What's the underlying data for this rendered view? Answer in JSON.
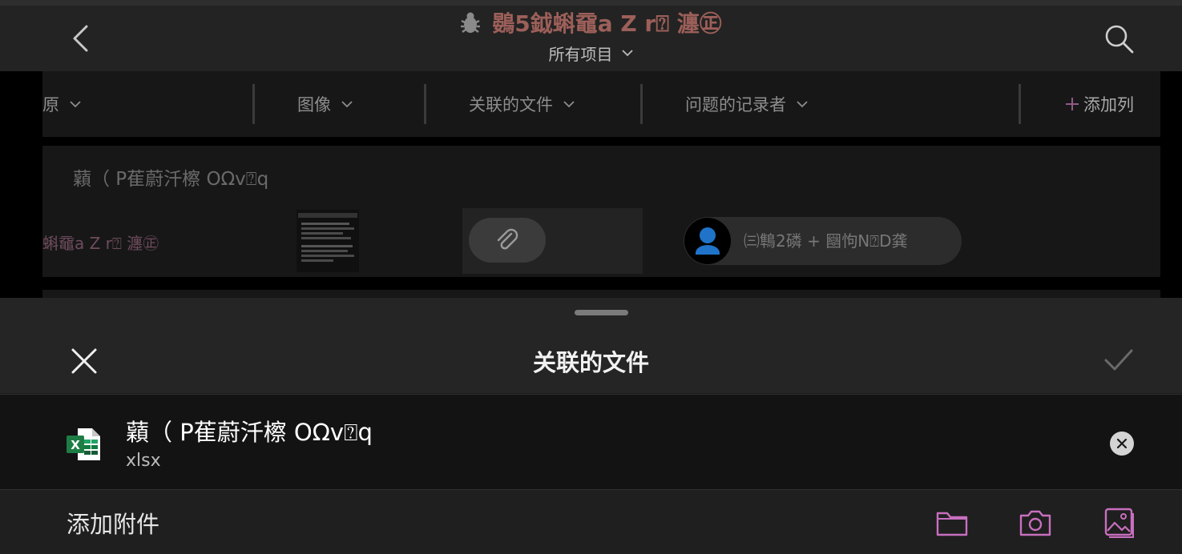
{
  "header": {
    "title": "鷃5鉞蝌黿a Z r⍰ 瀍㊣",
    "subtitle": "所有项目"
  },
  "columns": [
    {
      "label": "原"
    },
    {
      "label": "图像"
    },
    {
      "label": "关联的文件"
    },
    {
      "label": "问题的记录者"
    }
  ],
  "add_column_label": "添加列",
  "row": {
    "title": "蘔（ P萑蔚汘檫 OΩv⍰q",
    "link_text": "蝌黿a Z r⍰ 瀍㊣",
    "user_name": "㈢鶽2磷 + 圝怐N⍰D龚"
  },
  "sheet": {
    "title": "关联的文件",
    "file": {
      "name": "蘔（ P萑蔚汘檫 OΩv⍰q",
      "ext": "xlsx"
    },
    "add_attachment_label": "添加附件"
  },
  "colors": {
    "accent": "#c86fbf",
    "title": "#9c5f59",
    "excel": "#1e7d45"
  }
}
